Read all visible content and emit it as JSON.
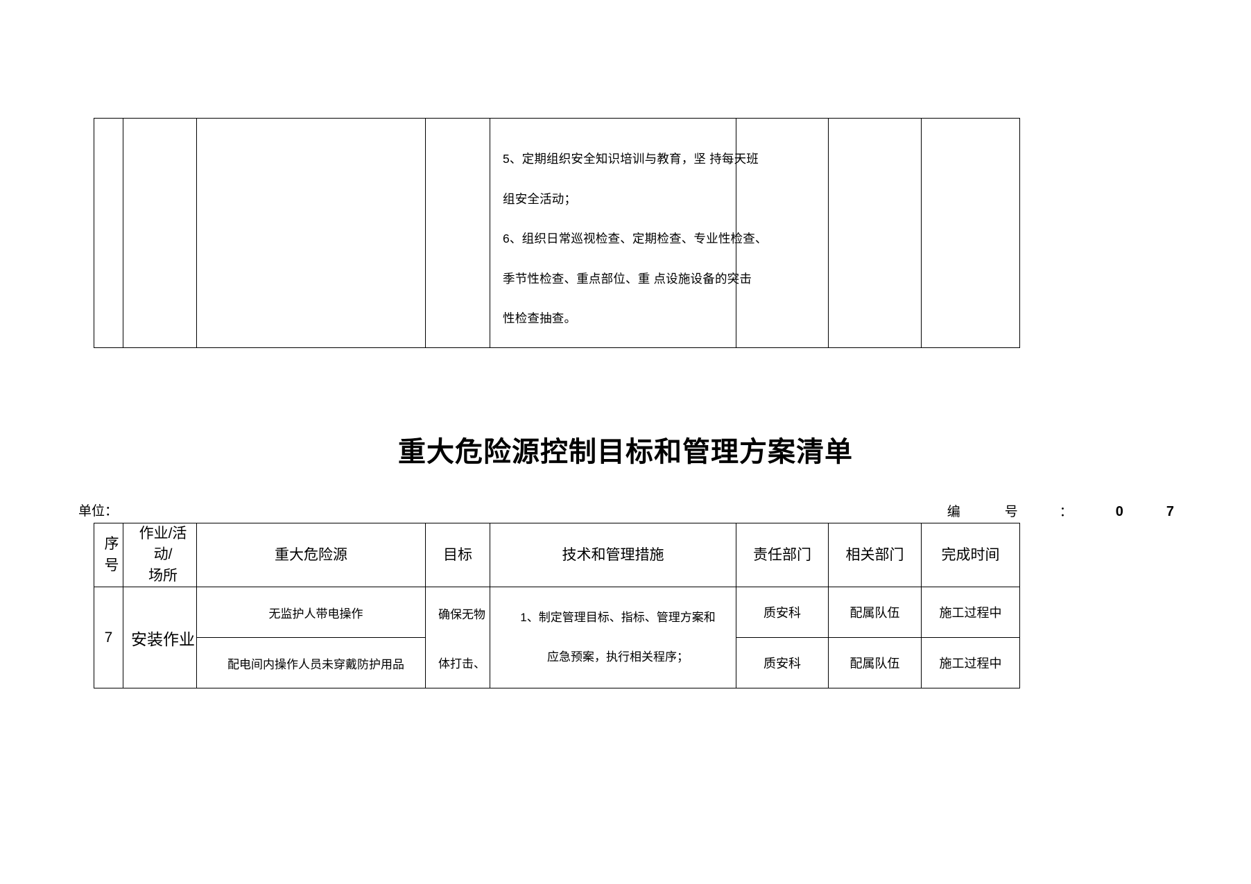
{
  "document": {
    "title": "重大危险源控制目标和管理方案清单"
  },
  "top_table": {
    "columns": 8,
    "measures": [
      "5、定期组织安全知识培训与教育，坚 持每天班",
      "组安全活动；",
      "6、组织日常巡视检查、定期检查、专业性检查、",
      "季节性检查、重点部位、重 点设施设备的突击",
      "性检查抽查。"
    ]
  },
  "meta": {
    "unit_label": "单位：",
    "number_label_1": "编",
    "number_label_2": "号",
    "number_colon": "：",
    "number_digit_1": "0",
    "number_digit_2": "7"
  },
  "main_table": {
    "headers": {
      "serial_line1": "序",
      "serial_line2": "号",
      "activity_line1": "作业/活 动/",
      "activity_line2": "场所",
      "hazard": "重大危险源",
      "goal": "目标",
      "measures": "技术和管理措施",
      "responsible_dept": "责任部门",
      "related_dept": "相关部门",
      "completion_time": "完成时间"
    },
    "rows": [
      {
        "serial": "7",
        "activity": "安装作业",
        "hazard": "无监护人带电操作",
        "goal": "确保无物",
        "measure": "1、制定管理目标、指标、管理方案和",
        "responsible_dept": "质安科",
        "related_dept": "配属队伍",
        "completion_time": "施工过程中"
      },
      {
        "serial": "",
        "activity": "",
        "hazard": "配电间内操作人员未穿戴防护用品",
        "goal": "体打击、",
        "measure": "应急预案，执行相关程序；",
        "responsible_dept": "质安科",
        "related_dept": "配属队伍",
        "completion_time": "施工过程中"
      }
    ]
  }
}
